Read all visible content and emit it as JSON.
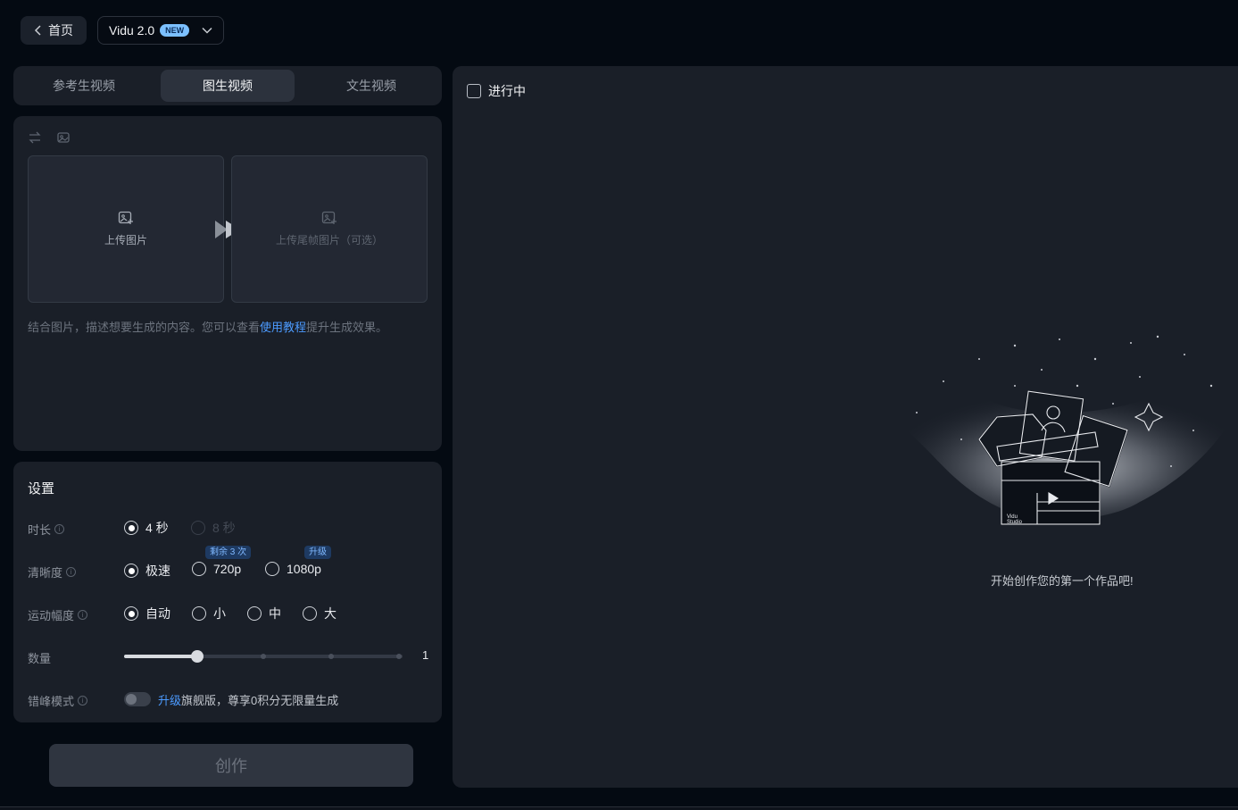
{
  "topbar": {
    "home_label": "首页",
    "model_name": "Vidu 2.0",
    "model_badge": "NEW"
  },
  "tabs": [
    {
      "label": "参考生视频",
      "active": false
    },
    {
      "label": "图生视频",
      "active": true
    },
    {
      "label": "文生视频",
      "active": false
    }
  ],
  "upload": {
    "first_frame_label": "上传图片",
    "last_frame_label": "上传尾帧图片（可选）",
    "hint_before": "结合图片，描述想要生成的内容。您可以查看",
    "hint_link": "使用教程",
    "hint_after": "提升生成效果。"
  },
  "settings": {
    "title": "设置",
    "duration": {
      "label": "时长",
      "options": [
        {
          "label": "4 秒",
          "checked": true,
          "disabled": false
        },
        {
          "label": "8 秒",
          "checked": false,
          "disabled": true
        }
      ]
    },
    "resolution": {
      "label": "清晰度",
      "options": [
        {
          "label": "极速",
          "checked": true
        },
        {
          "label": "720p",
          "checked": false,
          "tag": "剩余 3 次"
        },
        {
          "label": "1080p",
          "checked": false,
          "tag": "升级"
        }
      ]
    },
    "motion": {
      "label": "运动幅度",
      "options": [
        {
          "label": "自动",
          "checked": true
        },
        {
          "label": "小",
          "checked": false
        },
        {
          "label": "中",
          "checked": false
        },
        {
          "label": "大",
          "checked": false
        }
      ]
    },
    "quantity": {
      "label": "数量",
      "value": "1",
      "min": 1,
      "max": 4
    },
    "offpeak": {
      "label": "错峰模式",
      "enabled": false,
      "link": "升级",
      "text": "旗舰版，尊享0积分无限量生成"
    }
  },
  "create_label": "创作",
  "results": {
    "filter_label": "进行中",
    "empty_text": "开始创作您的第一个作品吧!",
    "illustration_caption_1": "Vidu",
    "illustration_caption_2": "Studio"
  },
  "colors": {
    "accent_link": "#4c9bff",
    "panel_bg": "#1a1f28",
    "page_bg": "#040a12"
  }
}
